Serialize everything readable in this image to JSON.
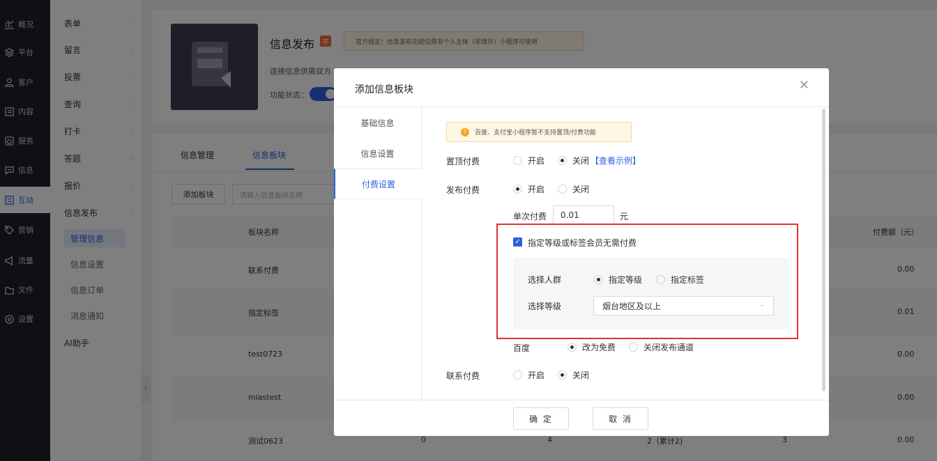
{
  "left_nav": [
    {
      "label": "概况",
      "icon": "chart-icon"
    },
    {
      "label": "平台",
      "icon": "layers-icon"
    },
    {
      "label": "客户",
      "icon": "user-icon"
    },
    {
      "label": "内容",
      "icon": "document-icon"
    },
    {
      "label": "服务",
      "icon": "service-icon"
    },
    {
      "label": "信息",
      "icon": "message-icon"
    },
    {
      "label": "互动",
      "icon": "interact-icon",
      "active": true
    },
    {
      "label": "营销",
      "icon": "tag-icon"
    },
    {
      "label": "流量",
      "icon": "megaphone-icon"
    },
    {
      "label": "文件",
      "icon": "folder-icon"
    },
    {
      "label": "设置",
      "icon": "settings-icon"
    }
  ],
  "sub_nav": {
    "items": [
      "表单",
      "留言",
      "投票",
      "查询",
      "打卡",
      "答题",
      "报价",
      "信息发布"
    ],
    "children": [
      "管理信息",
      "信息设置",
      "信息订单",
      "消息通知"
    ],
    "ai": "AI助手"
  },
  "plugin": {
    "title": "信息发布",
    "badge": "平",
    "notice": "官方规定：信息发布功能仅限非个人主体（非境外）小程序可使用",
    "desc": "连接信息供需双方",
    "status_label": "功能状态："
  },
  "tabs": [
    "信息管理",
    "信息板块"
  ],
  "toolbar": {
    "add_button": "添加板块",
    "search_placeholder": "请输入信息板块名称"
  },
  "table": {
    "headers": {
      "name": "板块名称",
      "fee": "付费额（元）"
    },
    "rows": [
      {
        "name": "联系付费",
        "fee": "0.00"
      },
      {
        "name": "指定标签",
        "fee": "0.01"
      },
      {
        "name": "test0723",
        "fee": "0.00"
      },
      {
        "name": "miastest",
        "fee": "0.00"
      },
      {
        "name": "测试0623",
        "c2": "0",
        "c3": "4",
        "c4": "2（累计2)",
        "c5": "3",
        "fee": "0.00"
      }
    ]
  },
  "modal": {
    "title": "添加信息板块",
    "side_tabs": [
      "基础信息",
      "信息设置",
      "付费设置"
    ],
    "notice": "百度、支付宝小程序暂不支持置顶/付费功能",
    "pin_fee": {
      "label": "置顶付费",
      "on": "开启",
      "off": "关闭",
      "link": "【查看示例】",
      "selected": "off"
    },
    "publish_fee": {
      "label": "发布付费",
      "on": "开启",
      "off": "关闭",
      "selected": "on"
    },
    "single_fee": {
      "label": "单次付费",
      "value": "0.01",
      "unit": "元"
    },
    "member_free": {
      "label": "指定等级或标签会员无需付费",
      "checked": true
    },
    "crowd": {
      "label": "选择人群",
      "opt1": "指定等级",
      "opt2": "指定标签",
      "selected": "opt1"
    },
    "level": {
      "label": "选择等级",
      "value": "烟台地区及以上"
    },
    "baidu": {
      "label": "百度",
      "opt1": "改为免费",
      "opt2": "关闭发布通道",
      "selected": "opt1"
    },
    "contact_fee": {
      "label": "联系付费",
      "on": "开启",
      "off": "关闭",
      "selected": "off"
    },
    "ok": "确 定",
    "cancel": "取 消"
  }
}
